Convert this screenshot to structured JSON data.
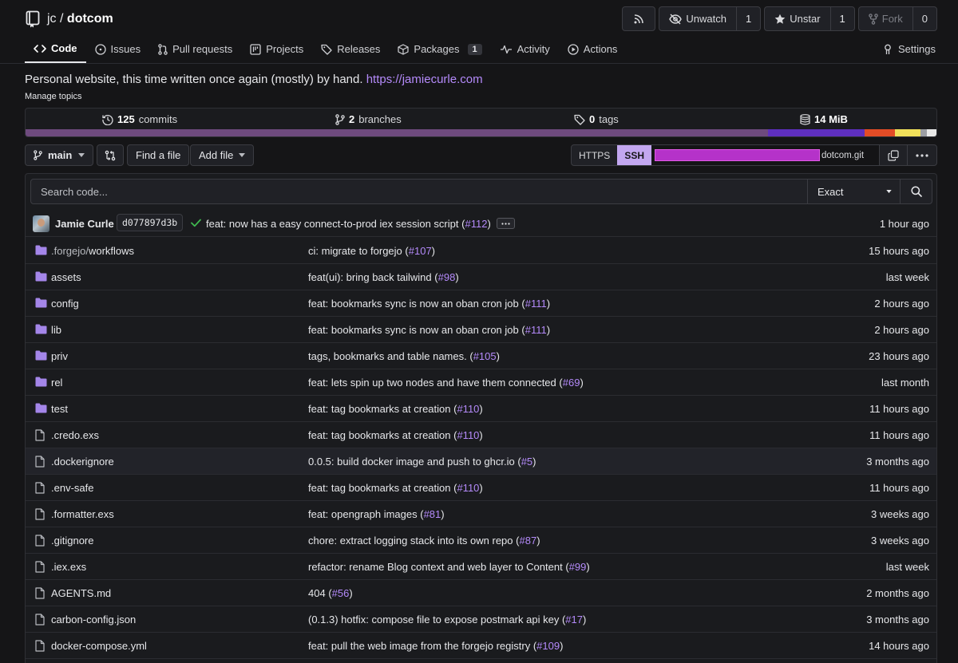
{
  "repo": {
    "owner": "jc",
    "separator": "/",
    "name": "dotcom"
  },
  "header_buttons": {
    "watch_label": "Unwatch",
    "watch_count": "1",
    "star_label": "Unstar",
    "star_count": "1",
    "fork_label": "Fork",
    "fork_count": "0"
  },
  "tabs": [
    {
      "label": "Code",
      "icon": "code-icon",
      "active": true
    },
    {
      "label": "Issues",
      "icon": "issue-icon"
    },
    {
      "label": "Pull requests",
      "icon": "pull-request-icon"
    },
    {
      "label": "Projects",
      "icon": "project-icon"
    },
    {
      "label": "Releases",
      "icon": "tag-icon"
    },
    {
      "label": "Packages",
      "icon": "package-icon",
      "badge": "1"
    },
    {
      "label": "Activity",
      "icon": "pulse-icon"
    },
    {
      "label": "Actions",
      "icon": "play-icon"
    }
  ],
  "settings_label": "Settings",
  "description": {
    "text": "Personal website, this time written once again (mostly) by hand.",
    "link": "https://jamiecurle.com",
    "manage_topics": "Manage topics"
  },
  "stats": {
    "commits_count": "125",
    "commits_label": "commits",
    "branches_count": "2",
    "branches_label": "branches",
    "tags_count": "0",
    "tags_label": "tags",
    "size_value": "14 MiB"
  },
  "language_colors": [
    "#6e4a7e",
    "#5e2fbf",
    "#e34c26",
    "#f1e05a",
    "#9c9ea3",
    "#e8e8e8"
  ],
  "toolbar": {
    "branch": "main",
    "find_file": "Find a file",
    "add_file": "Add file",
    "https_label": "HTTPS",
    "ssh_label": "SSH",
    "clone_url_suffix": "dotcom.git"
  },
  "search": {
    "placeholder": "Search code...",
    "mode": "Exact"
  },
  "latest_commit": {
    "author": "Jamie Curle",
    "sha": "d077897d3b",
    "message": "feat: now has a easy connect-to-prod iex session script",
    "pr": "#112",
    "time": "1 hour ago"
  },
  "files": [
    {
      "type": "dir",
      "prefix": ".forgejo/",
      "name": "workflows",
      "message": "ci: migrate to forgejo",
      "pr": "#107",
      "time": "15 hours ago"
    },
    {
      "type": "dir",
      "prefix": "",
      "name": "assets",
      "message": "feat(ui): bring back tailwind",
      "pr": "#98",
      "time": "last week"
    },
    {
      "type": "dir",
      "prefix": "",
      "name": "config",
      "message": "feat: bookmarks sync is now an oban cron job",
      "pr": "#111",
      "time": "2 hours ago"
    },
    {
      "type": "dir",
      "prefix": "",
      "name": "lib",
      "message": "feat: bookmarks sync is now an oban cron job",
      "pr": "#111",
      "time": "2 hours ago"
    },
    {
      "type": "dir",
      "prefix": "",
      "name": "priv",
      "message": "tags, bookmarks and table names.",
      "pr": "#105",
      "time": "23 hours ago"
    },
    {
      "type": "dir",
      "prefix": "",
      "name": "rel",
      "message": "feat: lets spin up two nodes and have them connected",
      "pr": "#69",
      "time": "last month"
    },
    {
      "type": "dir",
      "prefix": "",
      "name": "test",
      "message": "feat: tag bookmarks at creation",
      "pr": "#110",
      "time": "11 hours ago"
    },
    {
      "type": "file",
      "prefix": "",
      "name": ".credo.exs",
      "message": "feat: tag bookmarks at creation",
      "pr": "#110",
      "time": "11 hours ago"
    },
    {
      "type": "file",
      "prefix": "",
      "name": ".dockerignore",
      "message": "0.0.5: build docker image and push to ghcr.io",
      "pr": "#5",
      "time": "3 months ago",
      "highlight": true
    },
    {
      "type": "file",
      "prefix": "",
      "name": ".env-safe",
      "message": "feat: tag bookmarks at creation",
      "pr": "#110",
      "time": "11 hours ago"
    },
    {
      "type": "file",
      "prefix": "",
      "name": ".formatter.exs",
      "message": "feat: opengraph images",
      "pr": "#81",
      "time": "3 weeks ago"
    },
    {
      "type": "file",
      "prefix": "",
      "name": ".gitignore",
      "message": "chore: extract logging stack into its own repo",
      "pr": "#87",
      "time": "3 weeks ago"
    },
    {
      "type": "file",
      "prefix": "",
      "name": ".iex.exs",
      "message": "refactor: rename Blog context and web layer to Content",
      "pr": "#99",
      "time": "last week"
    },
    {
      "type": "file",
      "prefix": "",
      "name": "AGENTS.md",
      "message": "404",
      "pr": "#56",
      "time": "2 months ago"
    },
    {
      "type": "file",
      "prefix": "",
      "name": "carbon-config.json",
      "message": "(0.1.3) hotfix: compose file to expose postmark api key",
      "pr": "#17",
      "time": "3 months ago"
    },
    {
      "type": "file",
      "prefix": "",
      "name": "docker-compose.yml",
      "message": "feat: pull the web image from the forgejo registry",
      "pr": "#109",
      "time": "14 hours ago"
    }
  ]
}
